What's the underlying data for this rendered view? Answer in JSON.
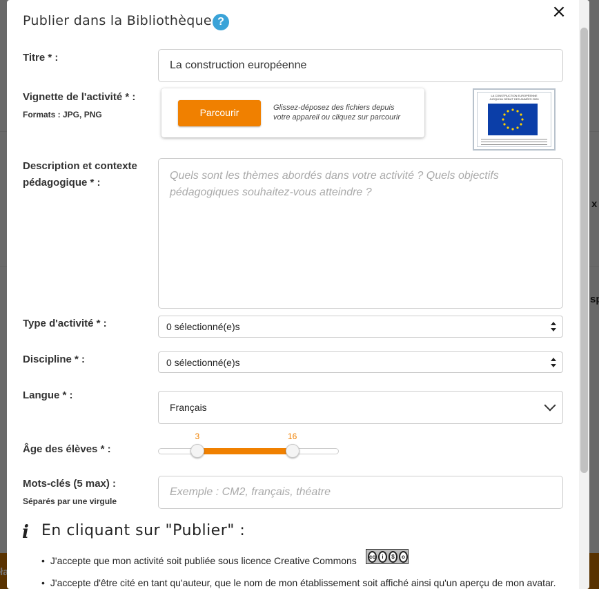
{
  "dialog": {
    "title": "Publier dans la Bibliothèque",
    "help_glyph": "?",
    "close_glyph": "×"
  },
  "background_edge": {
    "text_1": "x",
    "text_2": "sp",
    "text_3": "ła"
  },
  "fields": {
    "title": {
      "label": "Titre * :",
      "value": "La construction européenne"
    },
    "thumbnail": {
      "label": "Vignette de l'activité * :",
      "formats": "Formats : JPG, PNG",
      "browse_label": "Parcourir",
      "hint": "Glissez-déposez des fichiers depuis votre appareil ou cliquez sur parcourir",
      "preview_caption": "LA CONSTRUCTION EUROPÉENNE JUSQU'AU DÉBUT DES ANNÉES 2000"
    },
    "description": {
      "label": "Description et contexte pédagogique * :",
      "placeholder": "Quels sont les thèmes abordés dans votre activité ? Quels objectifs pédagogiques souhaitez-vous atteindre ?"
    },
    "activity_type": {
      "label": "Type d'activité * :",
      "value": "0 sélectionné(e)s"
    },
    "discipline": {
      "label": "Discipline * :",
      "value": "0 sélectionné(e)s"
    },
    "language": {
      "label": "Langue * :",
      "value": "Français"
    },
    "age": {
      "label": "Âge des élèves * :",
      "min_label": "3",
      "max_label": "16",
      "min": 3,
      "max": 16,
      "range_min": 0,
      "range_max": 20
    },
    "keywords": {
      "label": "Mots-clés (5 max) :",
      "sublabel": "Séparés par une virgule",
      "placeholder": "Exemple : CM2, français, théatre"
    }
  },
  "publish": {
    "heading": "En cliquant sur \"Publier\" :",
    "bullets": [
      "J'accepte que mon activité soit publiée sous licence Creative Commons",
      "J'accepte d'être cité en tant qu'auteur, que le nom de mon établissement soit affiché ainsi qu'un aperçu de mon avatar."
    ],
    "license_badge": "cc by nc sa"
  },
  "colors": {
    "accent": "#f08000",
    "help": "#3aa3d8",
    "eu_blue": "#0b3ea8",
    "eu_star": "#ffd200"
  },
  "icons": {
    "help": "question-circle-icon",
    "close": "close-icon",
    "info": "info-icon",
    "select": "sort-arrows-icon",
    "dropdown": "chevron-down-icon",
    "license": "creative-commons-icon"
  }
}
